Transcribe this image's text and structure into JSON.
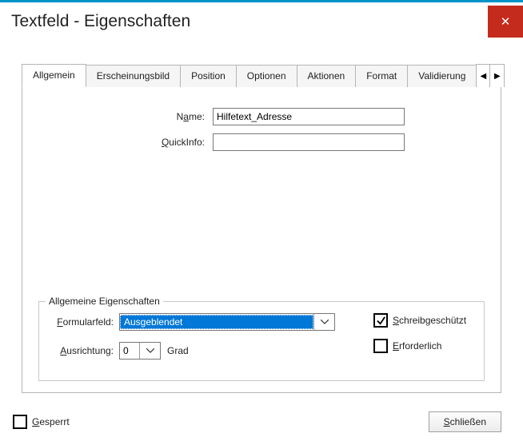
{
  "window": {
    "title": "Textfeld - Eigenschaften",
    "close_glyph": "✕"
  },
  "tabs": {
    "items": [
      "Allgemein",
      "Erscheinungsbild",
      "Position",
      "Optionen",
      "Aktionen",
      "Format",
      "Validierung"
    ],
    "nav_prev": "◀",
    "nav_next": "▶"
  },
  "general": {
    "name_label_pre": "N",
    "name_label_u": "a",
    "name_label_post": "me:",
    "name_value": "Hilfetext_Adresse",
    "quickinfo_label_u": "Q",
    "quickinfo_label_post": "uickInfo:",
    "quickinfo_value": ""
  },
  "props": {
    "legend": "Allgemeine Eigenschaften",
    "formfield_label_u": "F",
    "formfield_label_post": "ormularfeld:",
    "formfield_value": "Ausgeblendet",
    "orient_label_u": "A",
    "orient_label_post": "usrichtung:",
    "orient_value": "0",
    "orient_unit": "Grad",
    "readonly_label_u": "S",
    "readonly_label_post": "chreibgeschützt",
    "readonly_checked": true,
    "required_label_u": "E",
    "required_label_post": "rforderlich",
    "required_checked": false
  },
  "footer": {
    "locked_label_u": "G",
    "locked_label_post": "esperrt",
    "locked_checked": false,
    "close_btn_u": "S",
    "close_btn_post": "chließen"
  }
}
